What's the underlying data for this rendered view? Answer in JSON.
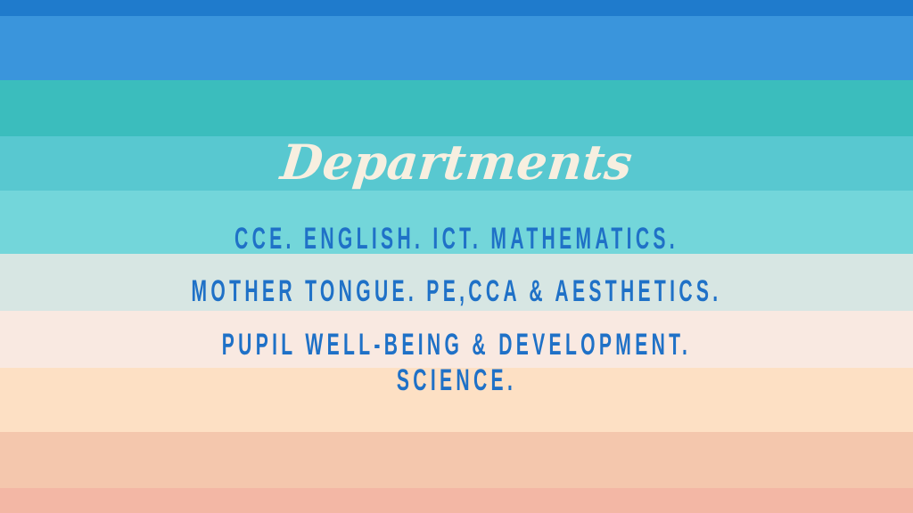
{
  "title": "Departments",
  "department_lines": [
    "CCE. ENGLISH. ICT. MATHEMATICS.",
    "MOTHER TONGUE. PE,CCA & AESTHETICS.",
    "PUPIL WELL-BEING & DEVELOPMENT. SCIENCE."
  ],
  "colors": {
    "stripes": [
      "#1f7bcc",
      "#3a95dc",
      "#3bbdbd",
      "#58c8d0",
      "#73d6da",
      "#d7e6e3",
      "#f9e9e1",
      "#fde0c4",
      "#f4c7ad",
      "#f3b7a5"
    ],
    "title_text": "#f7efe0",
    "body_text": "#1f71c7"
  }
}
